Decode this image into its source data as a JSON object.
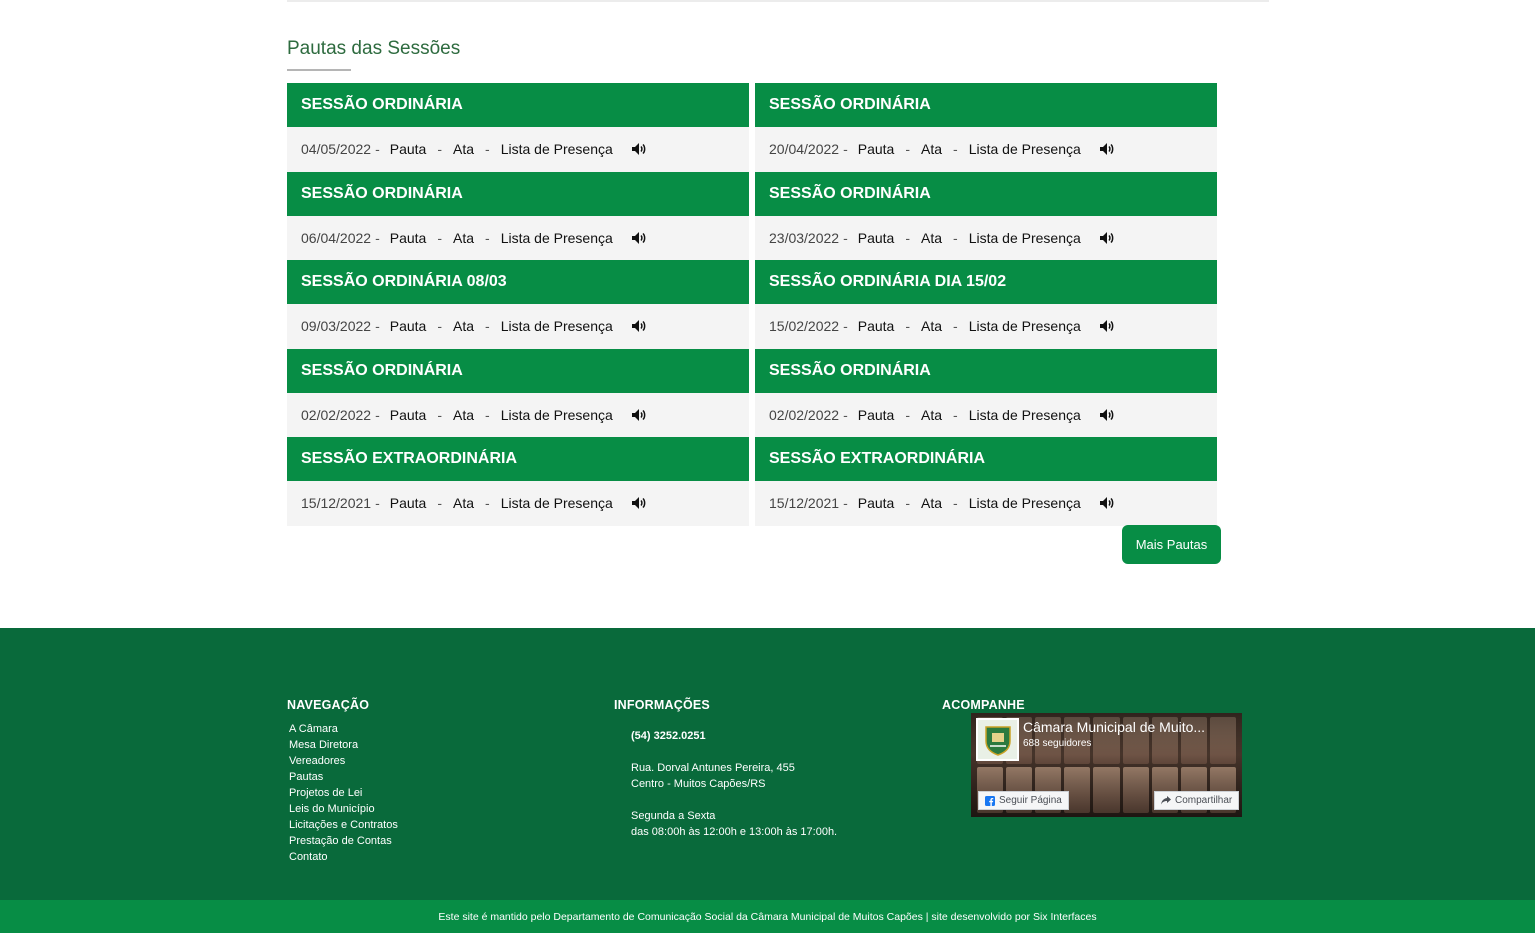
{
  "section": {
    "title": "Pautas das Sessões"
  },
  "sessions": [
    {
      "title": "SESSÃO ORDINÁRIA",
      "date": "04/05/2022",
      "pauta": "Pauta",
      "ata": "Ata",
      "presenca": "Lista de Presença"
    },
    {
      "title": "SESSÃO ORDINÁRIA",
      "date": "20/04/2022",
      "pauta": "Pauta",
      "ata": "Ata",
      "presenca": "Lista de Presença"
    },
    {
      "title": "SESSÃO ORDINÁRIA",
      "date": "06/04/2022",
      "pauta": "Pauta",
      "ata": "Ata",
      "presenca": "Lista de Presença"
    },
    {
      "title": "SESSÃO ORDINÁRIA",
      "date": "23/03/2022",
      "pauta": "Pauta",
      "ata": "Ata",
      "presenca": "Lista de Presença"
    },
    {
      "title": "SESSÃO ORDINÁRIA 08/03",
      "date": "09/03/2022",
      "pauta": "Pauta",
      "ata": "Ata",
      "presenca": "Lista de Presença"
    },
    {
      "title": "SESSÃO ORDINÁRIA DIA 15/02",
      "date": "15/02/2022",
      "pauta": "Pauta",
      "ata": "Ata",
      "presenca": "Lista de Presença"
    },
    {
      "title": "SESSÃO ORDINÁRIA",
      "date": "02/02/2022",
      "pauta": "Pauta",
      "ata": "Ata",
      "presenca": "Lista de Presença"
    },
    {
      "title": "SESSÃO ORDINÁRIA",
      "date": "02/02/2022",
      "pauta": "Pauta",
      "ata": "Ata",
      "presenca": "Lista de Presença"
    },
    {
      "title": "SESSÃO EXTRAORDINÁRIA",
      "date": "15/12/2021",
      "pauta": "Pauta",
      "ata": "Ata",
      "presenca": "Lista de Presença"
    },
    {
      "title": "SESSÃO EXTRAORDINÁRIA",
      "date": "15/12/2021",
      "pauta": "Pauta",
      "ata": "Ata",
      "presenca": "Lista de Presença"
    }
  ],
  "date_suffix": "-",
  "separator": "-",
  "audio_icon": "speaker-icon",
  "more_button": "Mais Pautas",
  "footer": {
    "nav_title": "NAVEGAÇÃO",
    "nav_items": [
      "A Câmara",
      "Mesa Diretora",
      "Vereadores",
      "Pautas",
      "Projetos de Lei",
      "Leis do Município",
      "Licitações e Contratos",
      "Prestação de Contas",
      "Contato"
    ],
    "info_title": "INFORMAÇÕES",
    "phone": "(54) 3252.0251",
    "address_line1": "Rua. Dorval Antunes Pereira, 455",
    "address_line2": "Centro - Muitos Capões/RS",
    "hours_line1": "Segunda a Sexta",
    "hours_line2": "das 08:00h às 12:00h e 13:00h às 17:00h.",
    "follow_title": "ACOMPANHE",
    "fb_page_name": "Câmara Municipal de Muito...",
    "fb_followers": "688 seguidores",
    "fb_follow_label": "Seguir Página",
    "fb_share_label": "Compartilhar"
  },
  "bottom_bar": "Este site é mantido pelo Departamento de Comunicação Social da Câmara Municipal de Muitos Capões | site desenvolvido por Six Interfaces",
  "colors": {
    "primary_green": "#078d45",
    "footer_green": "#096a3b",
    "title_green": "#2e6b3f",
    "card_body_bg": "#f4f4f4"
  }
}
